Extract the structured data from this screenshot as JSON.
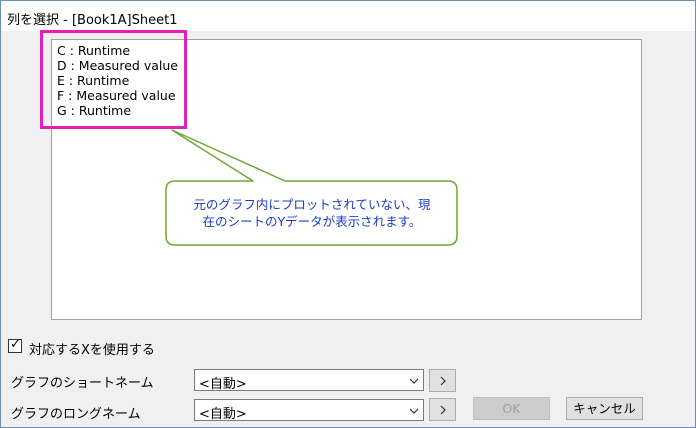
{
  "window": {
    "title": "列を選択 - [Book1A]Sheet1"
  },
  "columns": [
    {
      "label": "C : Runtime"
    },
    {
      "label": "D : Measured value"
    },
    {
      "label": "E : Runtime"
    },
    {
      "label": "F : Measured value"
    },
    {
      "label": "G : Runtime"
    }
  ],
  "callout": {
    "line1": "元のグラフ内にプロットされていない、現",
    "line2": "在のシートのYデータが表示されます。",
    "text_color": "#1a3dc9",
    "border_color": "#6fa63a"
  },
  "highlight_color": "#e61eb8",
  "use_x_checkbox": {
    "label": "対応するXを使用する",
    "checked": true
  },
  "short_name": {
    "label": "グラフのショートネーム",
    "value": "<自動>"
  },
  "long_name": {
    "label": "グラフのロングネーム",
    "value": "<自動>"
  },
  "buttons": {
    "ok": "OK",
    "cancel": "キャンセル"
  }
}
